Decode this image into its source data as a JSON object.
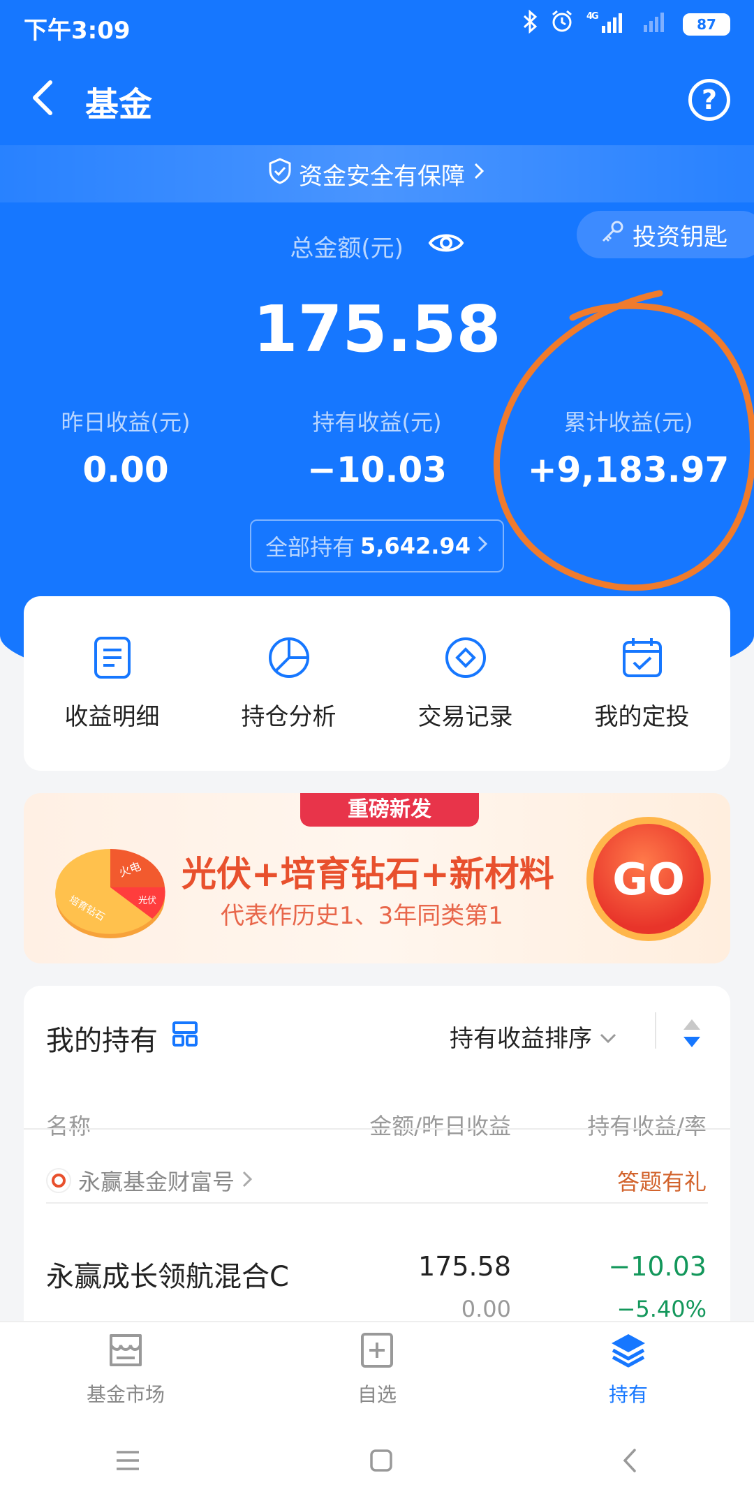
{
  "status_bar": {
    "time": "下午3:09",
    "network": "4G",
    "battery": "87"
  },
  "nav": {
    "title": "基金",
    "help": "?"
  },
  "safety_banner": {
    "label": "资金安全有保障"
  },
  "invest_key": {
    "label": "投资钥匙"
  },
  "summary": {
    "total_label": "总金额(元)",
    "total_value": "175.58",
    "stats": [
      {
        "label": "昨日收益(元)",
        "value": "0.00"
      },
      {
        "label": "持有收益(元)",
        "value": "−10.03"
      },
      {
        "label": "累计收益(元)",
        "value": "+9,183.97"
      }
    ],
    "hold_all_label": "全部持有",
    "hold_all_value": "5,642.94"
  },
  "actions": [
    {
      "label": "收益明细",
      "icon": "document-icon"
    },
    {
      "label": "持仓分析",
      "icon": "pie-chart-icon"
    },
    {
      "label": "交易记录",
      "icon": "record-icon"
    },
    {
      "label": "我的定投",
      "icon": "calendar-icon"
    }
  ],
  "promo": {
    "tag": "重磅新发",
    "title": "光伏+培育钻石+新材料",
    "subtitle": "代表作历史1、3年同类第1",
    "go": "GO",
    "pie_labels": [
      "火电",
      "光伏",
      "培育钻石"
    ]
  },
  "holdings": {
    "title": "我的持有",
    "sort_label": "持有收益排序",
    "columns": [
      "名称",
      "金额/昨日收益",
      "持有收益/率"
    ],
    "provider": "永赢基金财富号",
    "quiz_link": "答题有礼",
    "funds": [
      {
        "name": "永赢成长领航混合C",
        "amount": "175.58",
        "yesterday": "0.00",
        "hold_profit": "−10.03",
        "hold_rate": "−5.40%"
      }
    ]
  },
  "tabs": [
    {
      "label": "基金市场",
      "icon": "market-icon",
      "active": false
    },
    {
      "label": "自选",
      "icon": "watchlist-icon",
      "active": false
    },
    {
      "label": "持有",
      "icon": "holdings-layers-icon",
      "active": true
    }
  ],
  "colors": {
    "primary": "#1677ff",
    "loss_green": "#13975b",
    "annotation_orange": "#f07b2c",
    "promo_red": "#e8344a"
  }
}
